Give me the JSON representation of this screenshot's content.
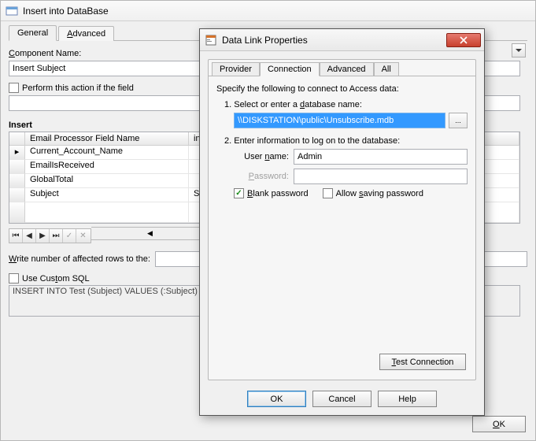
{
  "parent": {
    "title": "Insert into DataBase",
    "tabs": {
      "general": "General",
      "advanced": "Advanced"
    },
    "componentNameLabel": "Component Name:",
    "componentName": "Insert Subject",
    "performActionLabel": "Perform this action if the field",
    "insertHeading": "Insert",
    "grid": {
      "col1": "Email Processor Field Name",
      "col2": "into DB F",
      "rows": [
        {
          "name": "Current_Account_Name",
          "db": ""
        },
        {
          "name": "EmailIsReceived",
          "db": ""
        },
        {
          "name": "GlobalTotal",
          "db": ""
        },
        {
          "name": "Subject",
          "db": "Subject"
        }
      ]
    },
    "writeRowsLabel": "Write number of affected rows to the:",
    "useCustomSql": "Use Custom SQL",
    "sqlText": "INSERT INTO Test (Subject) VALUES (:Subject)",
    "okButton": "OK"
  },
  "dialog": {
    "title": "Data Link Properties",
    "tabs": {
      "provider": "Provider",
      "connection": "Connection",
      "advanced": "Advanced",
      "all": "All"
    },
    "instruction": "Specify the following to connect to Access data:",
    "step1Label": "1. Select or enter a database name:",
    "dbPath": "\\\\DISKSTATION\\public\\Unsubscribe.mdb",
    "browse": "...",
    "step2Label": "2. Enter information to log on to the database:",
    "userNameLabel": "User name:",
    "userName": "Admin",
    "passwordLabel": "Password:",
    "password": "",
    "blankPassword": "Blank password",
    "allowSaving": "Allow saving password",
    "testConnection": "Test Connection",
    "ok": "OK",
    "cancel": "Cancel",
    "help": "Help"
  }
}
